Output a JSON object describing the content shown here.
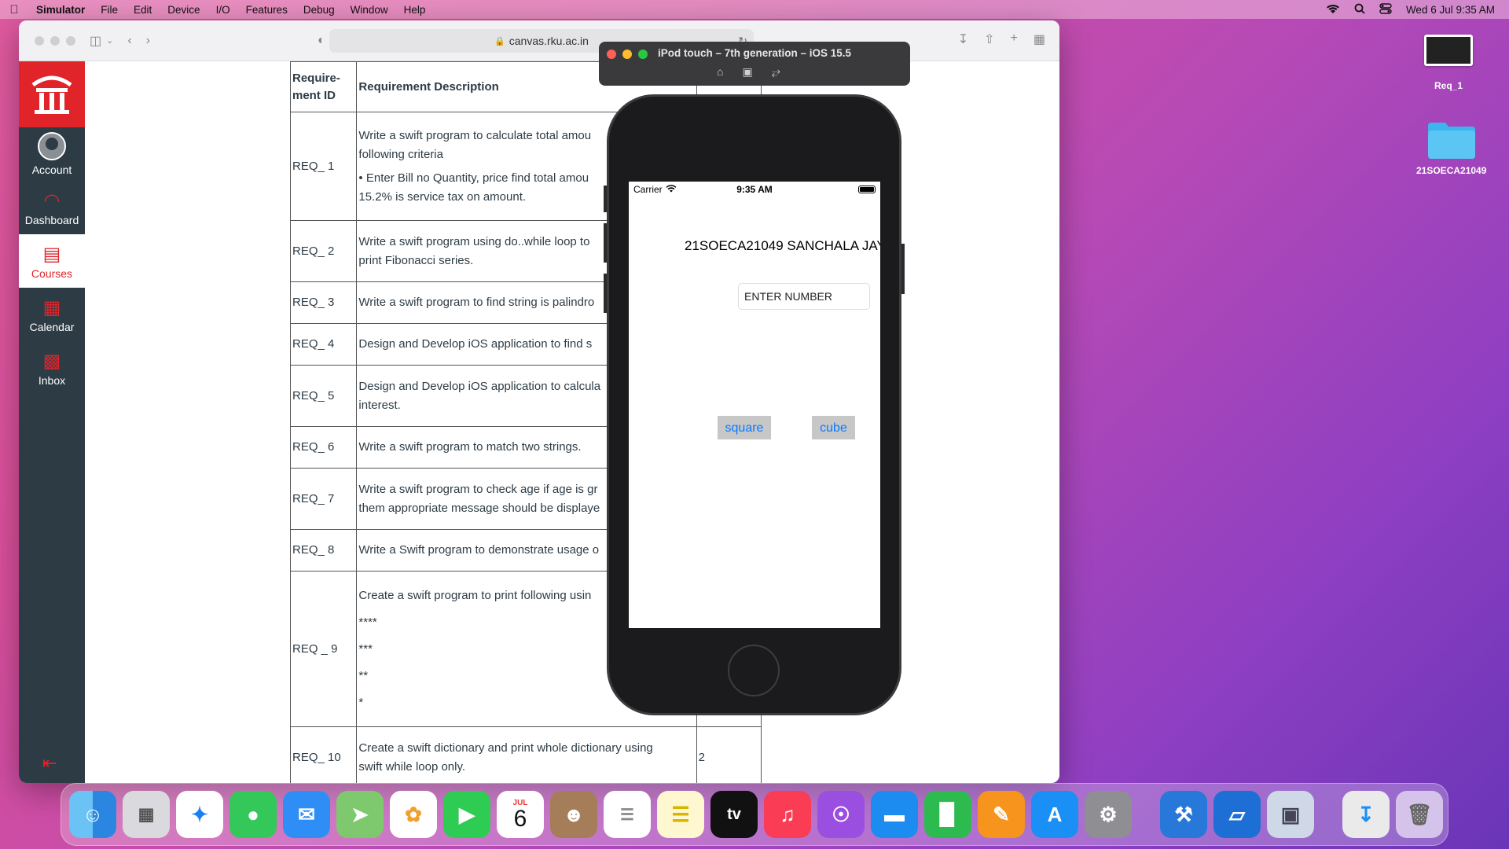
{
  "menubar": {
    "app": "Simulator",
    "items": [
      "File",
      "Edit",
      "Device",
      "I/O",
      "Features",
      "Debug",
      "Window",
      "Help"
    ],
    "clock": "Wed 6 Jul  9:35 AM"
  },
  "browser": {
    "url": "canvas.rku.ac.in",
    "nav": [
      {
        "label": "Account",
        "icon": "account-icon"
      },
      {
        "label": "Dashboard",
        "icon": "dashboard-icon"
      },
      {
        "label": "Courses",
        "icon": "courses-icon",
        "active": true
      },
      {
        "label": "Calendar",
        "icon": "calendar-icon"
      },
      {
        "label": "Inbox",
        "icon": "inbox-icon"
      }
    ],
    "table": {
      "headers": [
        "Require-ment ID",
        "Requirement Description"
      ],
      "rows": [
        {
          "id": "REQ_ 1",
          "desc": [
            "Write a swift program to calculate total amou",
            "following criteria",
            "•  Enter Bill no Quantity, price find total amou",
            "15.2% is service tax on amount."
          ]
        },
        {
          "id": "REQ_ 2",
          "desc": [
            "Write a swift program using do..while loop to",
            "print Fibonacci series."
          ]
        },
        {
          "id": "REQ_ 3",
          "desc": [
            "Write a swift program to find string is palindro"
          ]
        },
        {
          "id": "REQ_ 4",
          "desc": [
            "Design and Develop iOS application to find s"
          ]
        },
        {
          "id": "REQ_ 5",
          "desc": [
            "Design and Develop iOS application to calcula",
            "interest."
          ]
        },
        {
          "id": "REQ_ 6",
          "desc": [
            "Write a swift program to match two strings."
          ]
        },
        {
          "id": "REQ_ 7",
          "desc": [
            "Write a swift program to check age if age is gr",
            "them appropriate message should be displaye"
          ]
        },
        {
          "id": "REQ_ 8",
          "desc": [
            "Write a Swift program to demonstrate usage o"
          ]
        },
        {
          "id": "REQ _ 9",
          "desc": [
            "Create a swift program to print following usin",
            "****",
            "***",
            "**",
            "*"
          ]
        },
        {
          "id": "REQ_ 10",
          "desc": [
            "Create a swift dictionary and print whole dictionary using",
            "swift while loop only."
          ],
          "extra": "2"
        }
      ]
    }
  },
  "simulator": {
    "title": "iPod touch – 7th generation – iOS 15.5",
    "status": {
      "carrier": "Carrier",
      "time": "9:35 AM"
    },
    "app": {
      "title": "21SOECA21049 SANCHALA JAY",
      "input_placeholder": "ENTER NUMBER",
      "square_label": "square",
      "cube_label": "cube"
    }
  },
  "desktop": {
    "icons": [
      {
        "label": "Req_1",
        "icon": "screenshot-file-icon"
      },
      {
        "label": "21SOECA21049",
        "icon": "folder-icon"
      }
    ]
  },
  "dock": {
    "calendar_month": "JUL",
    "calendar_day": "6",
    "apps": [
      "Finder",
      "Launchpad",
      "Safari",
      "Messages",
      "Mail",
      "Maps",
      "Photos",
      "FaceTime",
      "Calendar",
      "Contacts",
      "Reminders",
      "Notes",
      "TV",
      "Music",
      "Podcasts",
      "Keynote",
      "Numbers",
      "Pages",
      "App Store",
      "System Preferences",
      "Xcode",
      "Simulator",
      "Preview",
      "Downloads",
      "Trash"
    ],
    "tv_label": "tv"
  },
  "colors": {
    "canvas_red": "#e0242a",
    "canvas_nav": "#2d3b45",
    "ios_blue": "#0a7aff"
  }
}
